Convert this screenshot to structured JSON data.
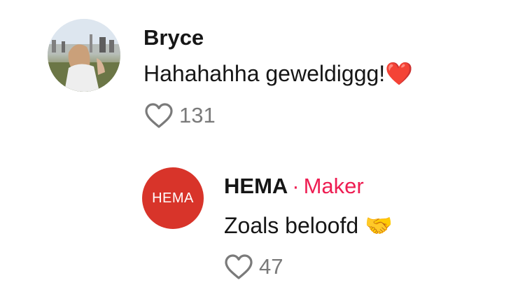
{
  "comments": [
    {
      "username": "Bryce",
      "text": "Hahahahha geweldiggg!",
      "emoji": "❤️",
      "likes": "131"
    }
  ],
  "reply": {
    "username": "HEMA",
    "separator": "·",
    "role_badge": "Maker",
    "avatar_logo_text": "HEMA",
    "text": "Zoals beloofd",
    "emoji": "🤝",
    "likes": "47"
  },
  "colors": {
    "maker_accent": "#ee1d52",
    "hema_red": "#d8342a",
    "like_count_gray": "#7a7a7a"
  },
  "icons": {
    "like": "heart-outline-icon"
  }
}
